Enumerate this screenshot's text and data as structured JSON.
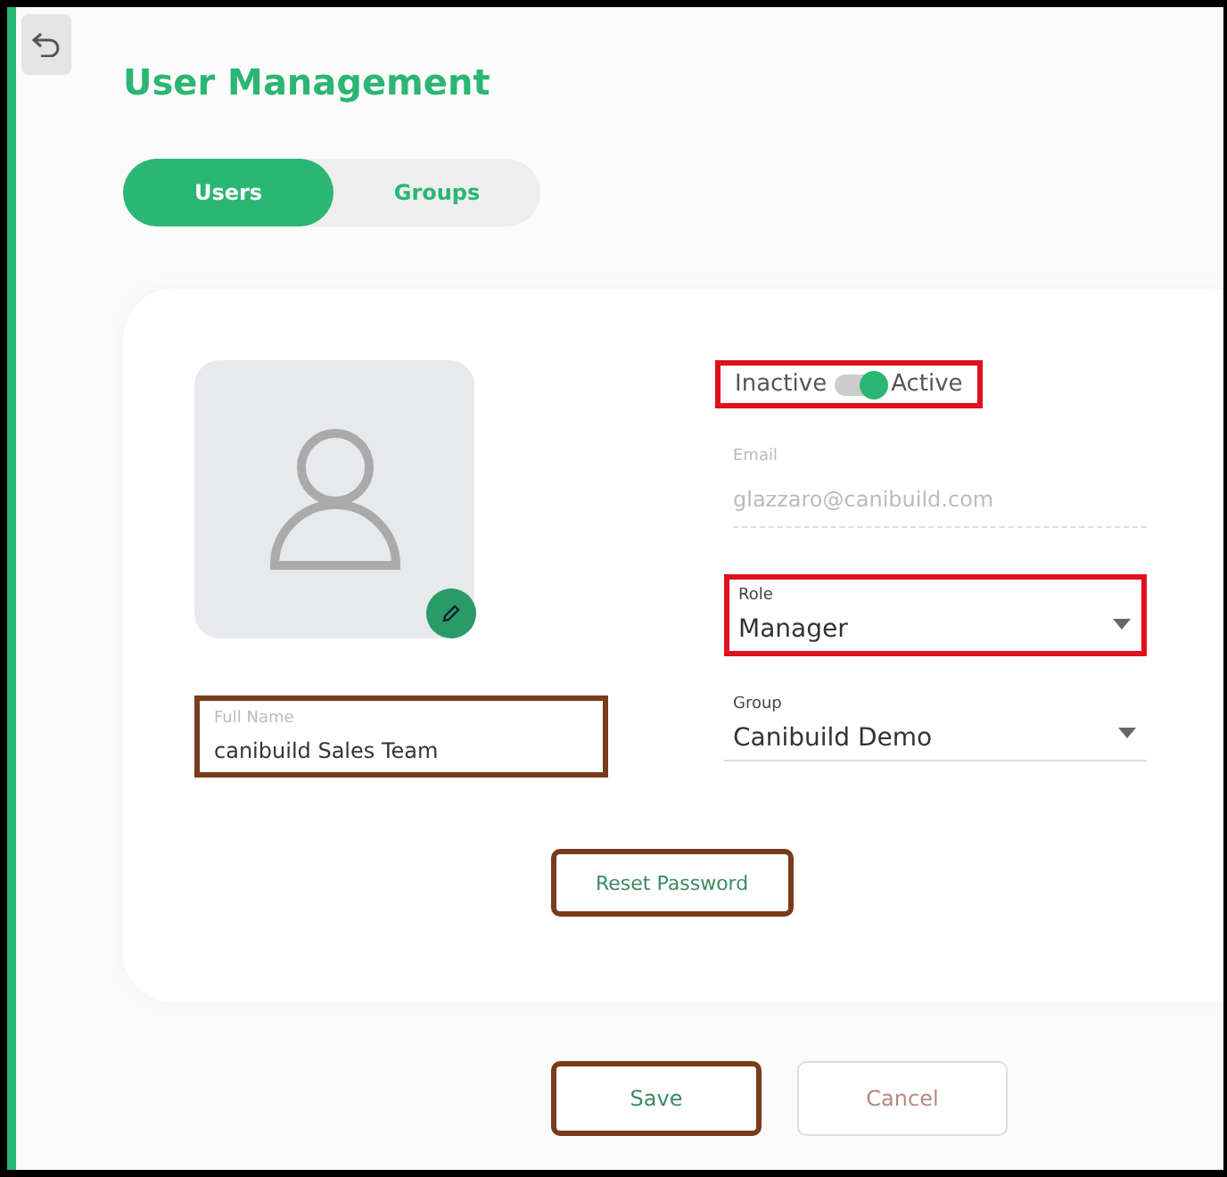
{
  "page": {
    "title": "User Management"
  },
  "tabs": [
    {
      "label": "Users",
      "selected": true
    },
    {
      "label": "Groups",
      "selected": false
    }
  ],
  "status": {
    "off_label": "Inactive",
    "on_label": "Active",
    "on": true,
    "color": "#e0101e"
  },
  "email": {
    "label": "Email",
    "value": "glazzaro@canibuild.com",
    "disabled": true
  },
  "role": {
    "label": "Role",
    "value": "Manager",
    "color": "#e0101e"
  },
  "full_name": {
    "label": "Full Name",
    "value": "canibuild Sales Team",
    "color": "#7a3b1c"
  },
  "group": {
    "label": "Group",
    "value": "Canibuild Demo"
  },
  "reset_button": {
    "label": "Reset Password",
    "color": "#7a3b1c"
  },
  "buttons": [
    {
      "label": "Save",
      "kind": "primary",
      "color": "#7a3b1c"
    },
    {
      "label": "Cancel",
      "kind": "secondary"
    }
  ]
}
